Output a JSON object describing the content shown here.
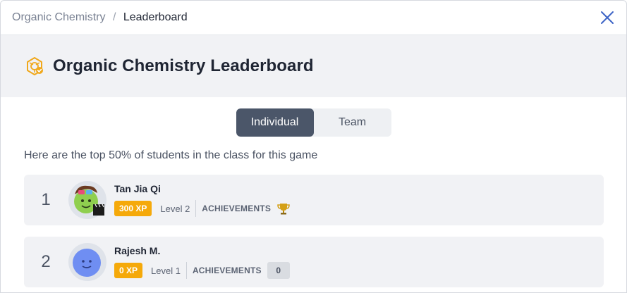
{
  "breadcrumb": {
    "parent": "Organic Chemistry",
    "separator": "/",
    "current": "Leaderboard"
  },
  "header": {
    "title": "Organic Chemistry Leaderboard",
    "icon": "chemistry-badge-icon"
  },
  "tabs": [
    {
      "label": "Individual",
      "active": true
    },
    {
      "label": "Team",
      "active": false
    }
  ],
  "subtitle": "Here are the top 50% of students in the class for this game",
  "leaderboard": [
    {
      "rank": "1",
      "name": "Tan Jia Qi",
      "xp": "300 XP",
      "level": "Level 2",
      "achievements_label": "ACHIEVEMENTS",
      "achievement_icon": "trophy-icon",
      "avatar": "green-avatar-with-goggles-and-clapperboard"
    },
    {
      "rank": "2",
      "name": "Rajesh M.",
      "xp": "0 XP",
      "level": "Level 1",
      "achievements_label": "ACHIEVEMENTS",
      "achievements_count": "0",
      "avatar": "blue-avatar"
    }
  ],
  "colors": {
    "accent": "#4b5669",
    "xp_badge": "#f5a90a",
    "header_bg": "#f1f2f5",
    "close_icon": "#3d64c6"
  }
}
